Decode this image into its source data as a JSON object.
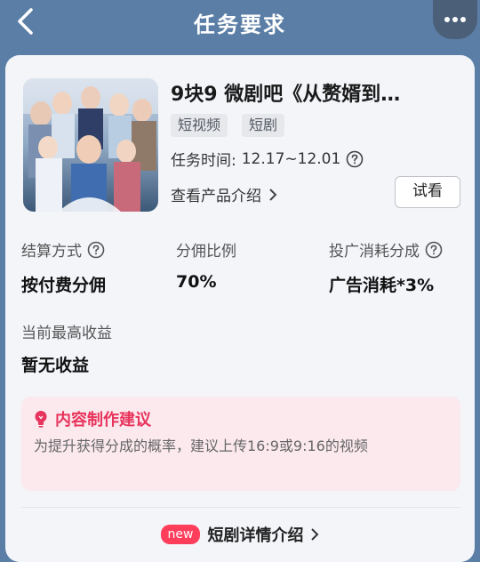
{
  "header": {
    "title": "任务要求"
  },
  "product": {
    "title": "9块9 微剧吧《从赘婿到…",
    "tags": [
      "短视频",
      "短剧"
    ],
    "task_time_label": "任务时间:",
    "task_time_value": "12.17~12.01",
    "product_intro": "查看产品介绍",
    "try_button": "试看"
  },
  "stats": {
    "settlement_label": "结算方式",
    "settlement_value": "按付费分佣",
    "commission_label": "分佣比例",
    "commission_value": "70%",
    "ad_label": "投广消耗分成",
    "ad_value": "广告消耗*3%",
    "max_income_label": "当前最高收益",
    "max_income_value": "暂无收益"
  },
  "tip": {
    "title": "内容制作建议",
    "text": "为提升获得分成的概率，建议上传16:9或9:16的视频"
  },
  "footer": {
    "badge": "new",
    "link": "短剧详情介绍"
  },
  "colors": {
    "header_bg": "#5b7ea6",
    "accent": "#e8345c",
    "new_badge": "#ff3e5c"
  }
}
